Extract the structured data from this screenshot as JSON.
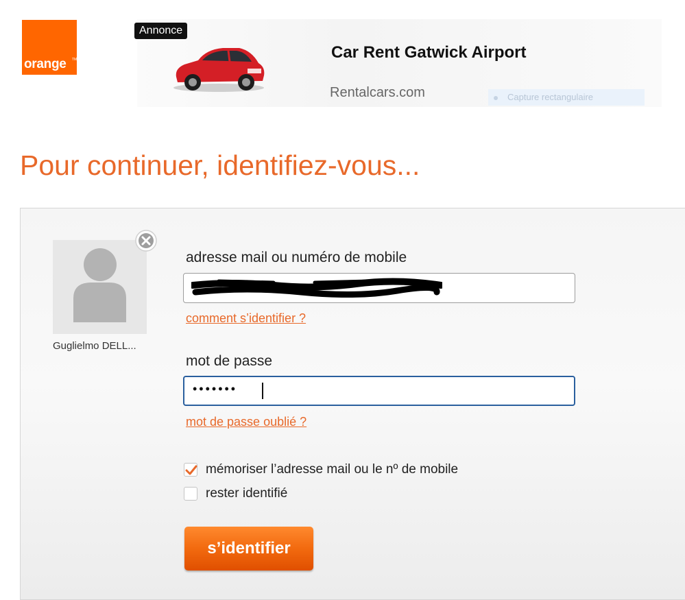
{
  "brand": {
    "logo_text": "orange",
    "color": "#ff6600"
  },
  "ad": {
    "badge": "Annonce",
    "title": "Car Rent Gatwick Airport",
    "source": "Rentalcars.com",
    "overlay_text": "Capture rectangulaire"
  },
  "heading": "Pour continuer, identifiez-vous...",
  "account": {
    "name": "Guglielmo DELL..."
  },
  "form": {
    "email_label": "adresse mail ou numéro de mobile",
    "email_value": "",
    "help_link": "comment s’identifier ?",
    "password_label": "mot de passe",
    "password_mask": "•••••••",
    "forgot_link": "mot de passe oublié ?",
    "remember_label": "mémoriser l’adresse mail ou le nº de mobile",
    "remember_checked": true,
    "stay_label": "rester identifié",
    "stay_checked": false,
    "submit_label": "s’identifier"
  },
  "colors": {
    "accent": "#e8692a",
    "focus_border": "#2a5f9e"
  }
}
